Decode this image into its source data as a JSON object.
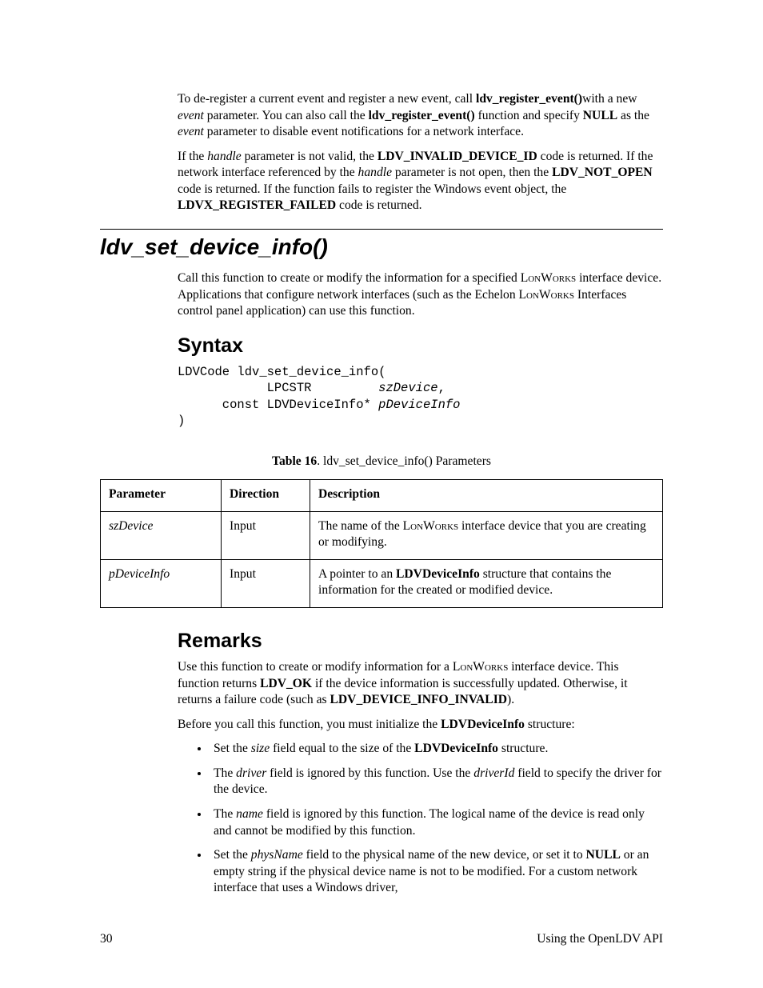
{
  "intro": {
    "p1_a": "To de-register a current event and register a new event, call ",
    "p1_b": "ldv_register_event()",
    "p1_c": "with a new ",
    "p1_d": "event",
    "p1_e": " parameter.  You can also call the ",
    "p1_f": "ldv_register_event()",
    "p1_g": " function and specify ",
    "p1_h": "NULL",
    "p1_i": " as the ",
    "p1_j": "event",
    "p1_k": " parameter to disable event notifications for a network interface.",
    "p2_a": "If the ",
    "p2_b": "handle",
    "p2_c": " parameter is not valid, the ",
    "p2_d": "LDV_INVALID_DEVICE_ID",
    "p2_e": " code is returned.  If the network interface referenced by the ",
    "p2_f": "handle",
    "p2_g": " parameter is not open, then the ",
    "p2_h": "LDV_NOT_OPEN",
    "p2_i": " code is returned.  If the function fails to register the Windows event object, the ",
    "p2_j": "LDVX_REGISTER_FAILED",
    "p2_k": " code is returned."
  },
  "func_title": "ldv_set_device_info()",
  "overview": {
    "a": "Call this function to create or modify the information for a specified ",
    "b": "LonWorks",
    "c": " interface device.  Applications that configure network interfaces (such as the Echelon ",
    "d": "LonWorks",
    "e": " Interfaces control panel application) can use this function."
  },
  "syntax_head": "Syntax",
  "code": {
    "l1": "LDVCode ldv_set_device_info(",
    "l2a": "            LPCSTR         ",
    "l2b": "szDevice",
    "l2c": ",",
    "l3a": "      const LDVDeviceInfo* ",
    "l3b": "pDeviceInfo",
    "l4": ")"
  },
  "table_caption_b": "Table 16",
  "table_caption_r": ". ldv_set_device_info() Parameters",
  "table": {
    "h1": "Parameter",
    "h2": "Direction",
    "h3": "Description",
    "r1c1": "szDevice",
    "r1c2": "Input",
    "r1c3a": "The name of the ",
    "r1c3b": "LonWorks",
    "r1c3c": " interface device that you are creating or modifying.",
    "r2c1": "pDeviceInfo",
    "r2c2": "Input",
    "r2c3a": "A pointer to an ",
    "r2c3b": "LDVDeviceInfo",
    "r2c3c": " structure that contains the information for the created or modified device."
  },
  "remarks_head": "Remarks",
  "remarks": {
    "p1a": "Use this function to create or modify information for a ",
    "p1b": "LonWorks",
    "p1c": " interface device.  This function returns ",
    "p1d": "LDV_OK",
    "p1e": " if the device information is successfully updated.  Otherwise, it returns a failure code (such as ",
    "p1f": "LDV_DEVICE_INFO_INVALID",
    "p1g": ").",
    "p2a": "Before you call this function, you must initialize the ",
    "p2b": "LDVDeviceInfo",
    "p2c": " structure:",
    "b1a": "Set the ",
    "b1b": "size",
    "b1c": " field equal to the size of the ",
    "b1d": "LDVDeviceInfo",
    "b1e": " structure.",
    "b2a": "The ",
    "b2b": "driver",
    "b2c": " field is ignored by this function.  Use the ",
    "b2d": "driverId",
    "b2e": " field to specify the driver for the device.",
    "b3a": "The ",
    "b3b": "name",
    "b3c": " field is ignored by this function.  The logical name of the device is read only and cannot be modified by this function.",
    "b4a": "Set the ",
    "b4b": "physName",
    "b4c": " field to the physical name of the new device, or set it to ",
    "b4d": "NULL",
    "b4e": " or an empty string if the physical device name is not to be modified.  For a custom network interface that uses a Windows driver,"
  },
  "footer_left": "30",
  "footer_right": "Using the OpenLDV API"
}
